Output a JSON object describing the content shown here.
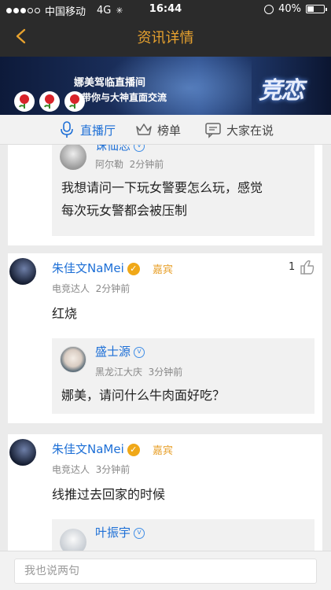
{
  "status_bar": {
    "carrier": "中国移动",
    "network": "4G",
    "time": "16:44",
    "battery": "40%",
    "battery_level": 0.4
  },
  "nav": {
    "title": "资讯详情"
  },
  "banner": {
    "line1": "娜美驾临直播间",
    "line2": "带你与大神直面交流",
    "brand": "竞恋"
  },
  "tabs": [
    {
      "label": "直播厅",
      "icon": "microphone-icon",
      "active": true
    },
    {
      "label": "榜单",
      "icon": "crown-icon",
      "active": false
    },
    {
      "label": "大家在说",
      "icon": "chat-icon",
      "active": false
    }
  ],
  "comments": [
    {
      "quote": {
        "name": "诛仙恋",
        "location": "阿尔勒",
        "time": "2分钟前",
        "text_line1": "我想请问一下玩女警要怎么玩，感觉",
        "text_line2": "每次玩女警都会被压制"
      }
    },
    {
      "name": "朱佳文NaMei",
      "badge": "嘉宾",
      "title": "电竞达人",
      "time": "2分钟前",
      "likes": "1",
      "text": "红烧",
      "quote": {
        "name": "盛士源",
        "location": "黑龙江大庆",
        "time": "3分钟前",
        "text": "娜美，请问什么牛肉面好吃？"
      }
    },
    {
      "name": "朱佳文NaMei",
      "badge": "嘉宾",
      "title": "电竞达人",
      "time": "3分钟前",
      "text": "线推过去回家的时候",
      "quote": {
        "name": "叶振宇"
      }
    }
  ],
  "input": {
    "placeholder": "我也说两句"
  }
}
